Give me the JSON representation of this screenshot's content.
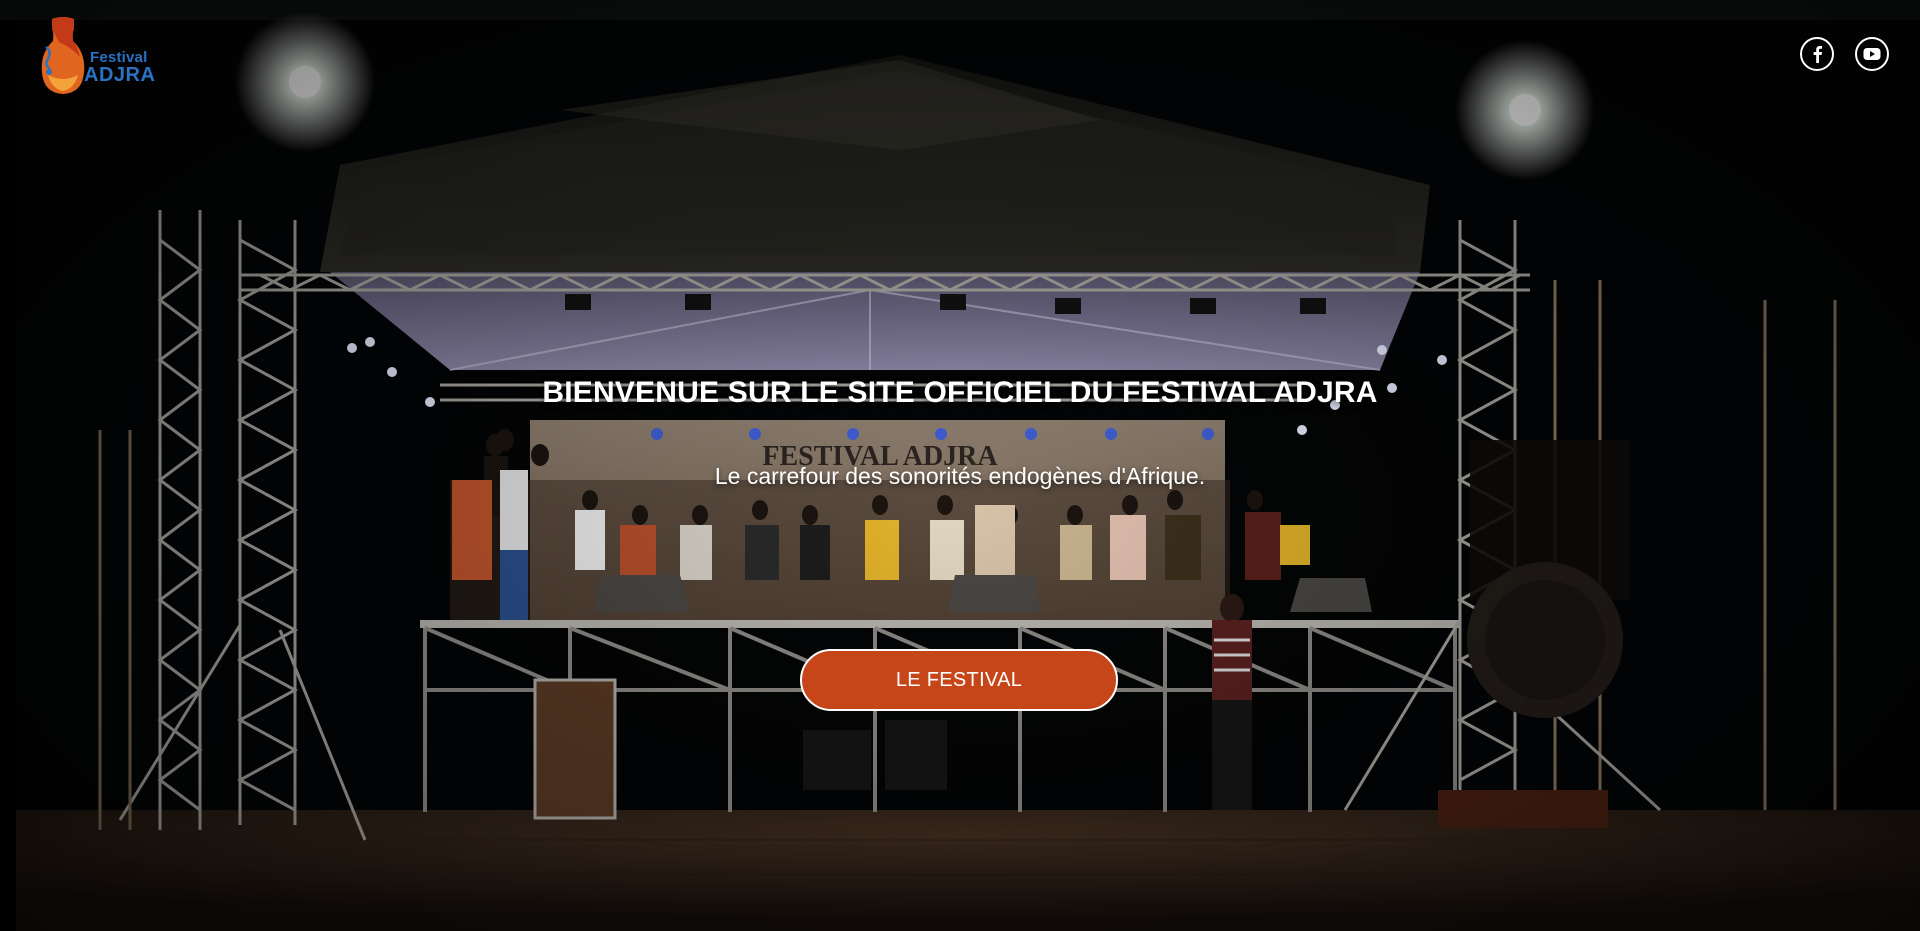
{
  "header": {
    "logo": {
      "line1": "Festival",
      "line2": "ADJRA",
      "brand_blue": "#2a72c4",
      "brand_orange": "#e0661f"
    },
    "social": [
      {
        "name": "facebook",
        "icon": "facebook-icon",
        "glyph": "f"
      },
      {
        "name": "youtube",
        "icon": "youtube-icon"
      }
    ]
  },
  "hero": {
    "title": "BIENVENUE SUR LE SITE OFFICIEL DU FESTIVAL ADJRA",
    "subtitle": "Le carrefour des sonorités endogènes d'Afrique.",
    "cta_label": "LE FESTIVAL",
    "banner_text": "FESTIVAL ADJRA",
    "accent_color": "#c64519"
  }
}
